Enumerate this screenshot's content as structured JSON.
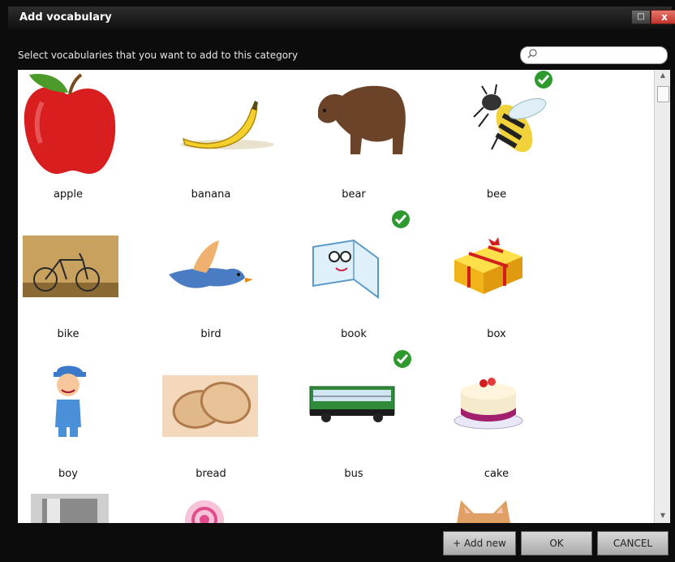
{
  "window": {
    "title": "Add vocabulary",
    "close_glyph": "x",
    "maximize_glyph": "□"
  },
  "instruction": "Select vocabularies that you want to add to this category",
  "search": {
    "placeholder": ""
  },
  "items": [
    {
      "label": "apple",
      "icon": "apple-icon",
      "checked": false
    },
    {
      "label": "banana",
      "icon": "banana-icon",
      "checked": false
    },
    {
      "label": "bear",
      "icon": "bear-icon",
      "checked": false
    },
    {
      "label": "bee",
      "icon": "bee-icon",
      "checked": true
    },
    {
      "label": "bike",
      "icon": "bike-icon",
      "checked": false
    },
    {
      "label": "bird",
      "icon": "bird-icon",
      "checked": false
    },
    {
      "label": "book",
      "icon": "book-icon",
      "checked": true
    },
    {
      "label": "box",
      "icon": "box-icon",
      "checked": false
    },
    {
      "label": "boy",
      "icon": "boy-icon",
      "checked": false
    },
    {
      "label": "bread",
      "icon": "bread-icon",
      "checked": false
    },
    {
      "label": "bus",
      "icon": "bus-icon",
      "checked": true
    },
    {
      "label": "cake",
      "icon": "cake-icon",
      "checked": false
    }
  ],
  "buttons": {
    "add_new": "+ Add new",
    "ok": "OK",
    "cancel": "CANCEL"
  },
  "colors": {
    "check": "#2e9a2e",
    "titlebar": "#1c1c1c",
    "close": "#c0342a"
  }
}
